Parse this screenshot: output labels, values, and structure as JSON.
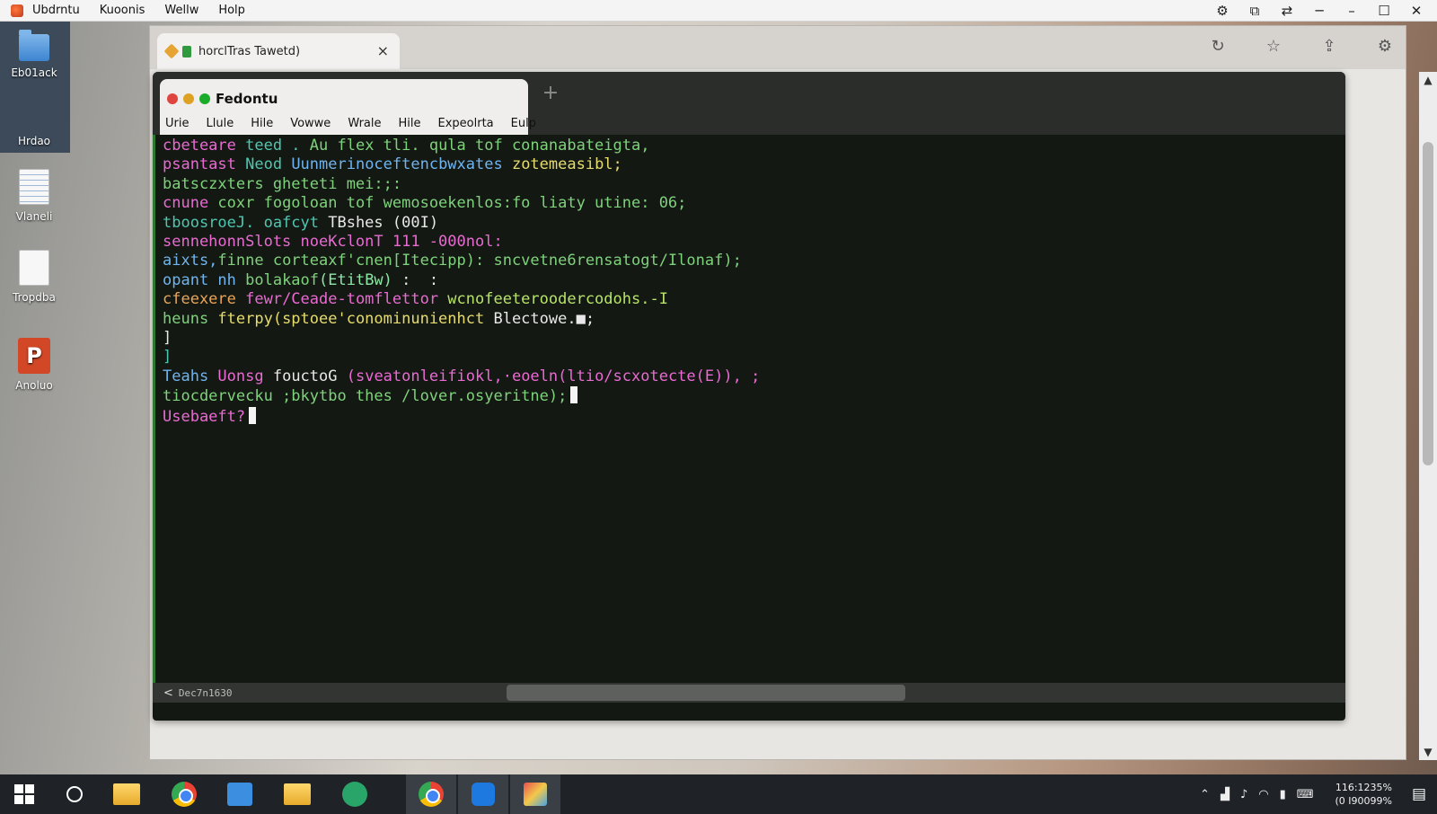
{
  "menubar": {
    "items": [
      "Ubdrntu",
      "Kuoonis",
      "Wellw",
      "Holp"
    ],
    "icons": [
      "settings-off-icon",
      "screen-share-icon",
      "shuffle-icon",
      "minimize-icon",
      "restore-icon",
      "maximize-icon",
      "close-icon"
    ]
  },
  "desktop": {
    "strip_label": "Hrdao",
    "icons": [
      {
        "label": "Eb01ack",
        "icon": "folder-icon"
      },
      {
        "label": "Vlaneli",
        "icon": "document-icon"
      },
      {
        "label": "Tropdba",
        "icon": "blank-document-icon"
      },
      {
        "label": "Anoluo",
        "icon": "presentation-icon"
      }
    ]
  },
  "browser": {
    "tab_title": "horclTras Tawetd)",
    "tab_close": "×",
    "toolbar_icons": [
      "refresh-icon",
      "star-icon",
      "share-icon",
      "settings-icon"
    ]
  },
  "terminal": {
    "title": "Fedontu",
    "menu": [
      "Urie",
      "Llule",
      "Hile",
      "Vowwe",
      "Wrale",
      "Hile",
      "Expeolrta",
      "Eulp"
    ],
    "new_tab": "+",
    "lines": [
      [
        {
          "t": "cbeteare ",
          "c": "pink"
        },
        {
          "t": "teed . ",
          "c": "teal"
        },
        {
          "t": "Au flex tli. qula tof conanabateigta,",
          "c": "green"
        }
      ],
      [
        {
          "t": "psantast ",
          "c": "pink"
        },
        {
          "t": "Neod ",
          "c": "teal"
        },
        {
          "t": "Uunmerinoceftencbwxates ",
          "c": "blue"
        },
        {
          "t": "zotemeasibl;",
          "c": "yellow"
        }
      ],
      [
        {
          "t": "batsczxters gheteti mei:;:",
          "c": "green"
        }
      ],
      [
        {
          "t": "cnune ",
          "c": "pink"
        },
        {
          "t": "coxr fogoloan tof wemosoekenlos:fo liaty utine: 06;",
          "c": "green"
        }
      ],
      [
        {
          "t": "tboosroeJ. oafcyt ",
          "c": "teal"
        },
        {
          "t": "TBshes (00I)",
          "c": "white"
        }
      ],
      [
        {
          "t": "sennehonnSlots noeKclonT 111 -000nol:",
          "c": "pink"
        }
      ],
      [
        {
          "t": "aixts,",
          "c": "blue"
        },
        {
          "t": "finne corteaxf'cnen[Itecipp): ",
          "c": "green"
        },
        {
          "t": "sncvetne6rensatogt/Ilonaf);",
          "c": "green"
        }
      ],
      [
        {
          "t": "opant nh ",
          "c": "blue"
        },
        {
          "t": "bolakaof",
          "c": "green"
        },
        {
          "t": "(EtitBw)",
          "c": "mint"
        },
        {
          "t": " :  :",
          "c": "white"
        }
      ],
      [
        {
          "t": "cfeexere ",
          "c": "orange"
        },
        {
          "t": "fewr/Ceade-tomflettor ",
          "c": "pink"
        },
        {
          "t": "wcnofeeteroodercodohs.-I",
          "c": "lime"
        }
      ],
      [
        {
          "t": "heuns ",
          "c": "green"
        },
        {
          "t": "fterpy(sptoee'conominunienhct ",
          "c": "yellow"
        },
        {
          "t": "Blectowe.",
          "c": "white"
        },
        {
          "t": "■;",
          "c": "white"
        }
      ],
      [
        {
          "t": "]",
          "c": "white"
        }
      ],
      [
        {
          "t": "]",
          "c": "teal"
        }
      ],
      [
        {
          "t": "Teahs ",
          "c": "blue"
        },
        {
          "t": "Uonsg ",
          "c": "pink"
        },
        {
          "t": "fouctoG ",
          "c": "white"
        },
        {
          "t": "(sveatonleifiokl,·eoeln(ltio/scxotecte(E)), ;",
          "c": "pink"
        }
      ],
      [
        {
          "t": "tiocdervecku ;bkytbo thes /lover.osyeritne);",
          "c": "green"
        }
      ],
      [
        {
          "t": "Usebaeft?",
          "c": "pink"
        }
      ]
    ],
    "status_text": "Dec7n1630",
    "status_arrow": "<"
  },
  "scrollbar": {
    "up": "▲",
    "down": "▼"
  },
  "taskbar": {
    "apps": [
      "windows-start-icon",
      "search-icon",
      "file-explorer-icon",
      "chrome-icon",
      "files-icon",
      "folder-icon",
      "messaging-icon",
      "chrome-icon",
      "video-call-icon",
      "paint-icon"
    ],
    "tray_icons": [
      "chevron-up-icon",
      "network-icon",
      "volume-icon",
      "wifi-icon",
      "battery-icon",
      "keyboard-icon"
    ],
    "clock_time": "116:1235%",
    "clock_date": "(0 I90099%",
    "notification_icon": "notification-icon"
  }
}
